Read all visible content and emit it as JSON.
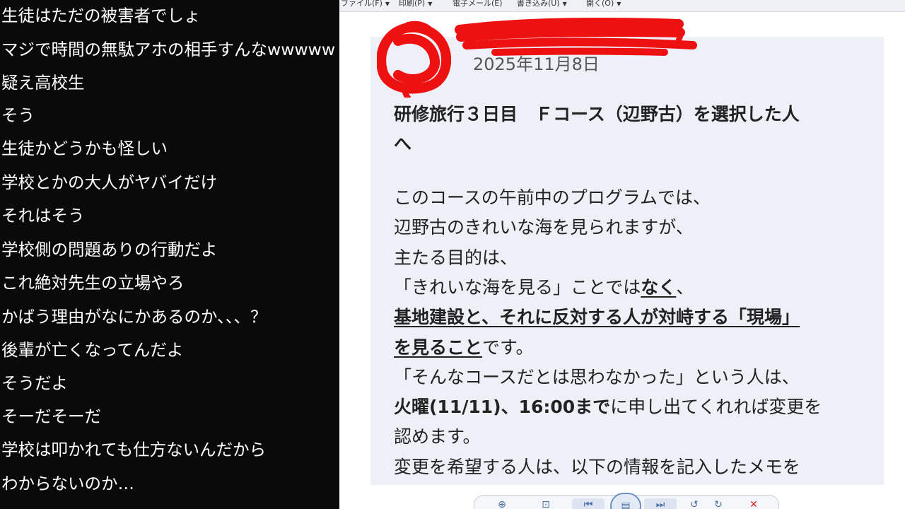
{
  "comments": [
    "生徒はただの被害者でしょ",
    "マジで時間の無駄アホの相手すんなwwwww",
    "疑え高校生",
    "そう",
    "生徒かどうかも怪しい",
    "学校とかの大人がヤバイだけ",
    "それはそう",
    "学校側の問題ありの行動だよ",
    "これ絶対先生の立場やろ",
    "かばう理由がなにかあるのか、、、？",
    "後輩が亡くなってんだよ",
    "そうだよ",
    "そーだそーだ",
    "学校は叩かれても仕方ないんだから",
    "わからないのか…"
  ],
  "menu": [
    "ファイル(F)",
    "印刷(P)",
    "電子メール(E)",
    "書き込み(U)",
    "開く(O)"
  ],
  "doc": {
    "date": "2025年11月8日",
    "title_line1": "研修旅行３日目　Ｆコース（辺野古）を選択した人",
    "title_line2": "へ",
    "p1": "このコースの午前中のプログラムでは、",
    "p2": "辺野古のきれいな海を見られますが、",
    "p3": "主たる目的は、",
    "p4a": "「きれいな海を見る」ことでは",
    "p4b": "なく",
    "p4c": "、",
    "p5": "基地建設と、それに反対する人が対峙する「現場」",
    "p6a": "を見ること",
    "p6b": "です。",
    "p7": "「そんなコースだとは思わなかった」という人は、",
    "p8a": "火曜(11/11)、16:00まで",
    "p8b": "に申し出てくれれば変更を",
    "p9": "認めます。",
    "p10": "変更を希望する人は、以下の情報を記入したメモを"
  },
  "colors": {
    "redaction": "#ee1111",
    "comment_bg": "#0a0a0a",
    "doc_bg": "#eef0f8"
  },
  "toolbar_icons": [
    "zoom-in-icon",
    "fit-page-icon",
    "first-page-icon",
    "page-view-icon",
    "last-page-icon",
    "rotate-left-icon",
    "rotate-right-icon",
    "delete-icon"
  ]
}
